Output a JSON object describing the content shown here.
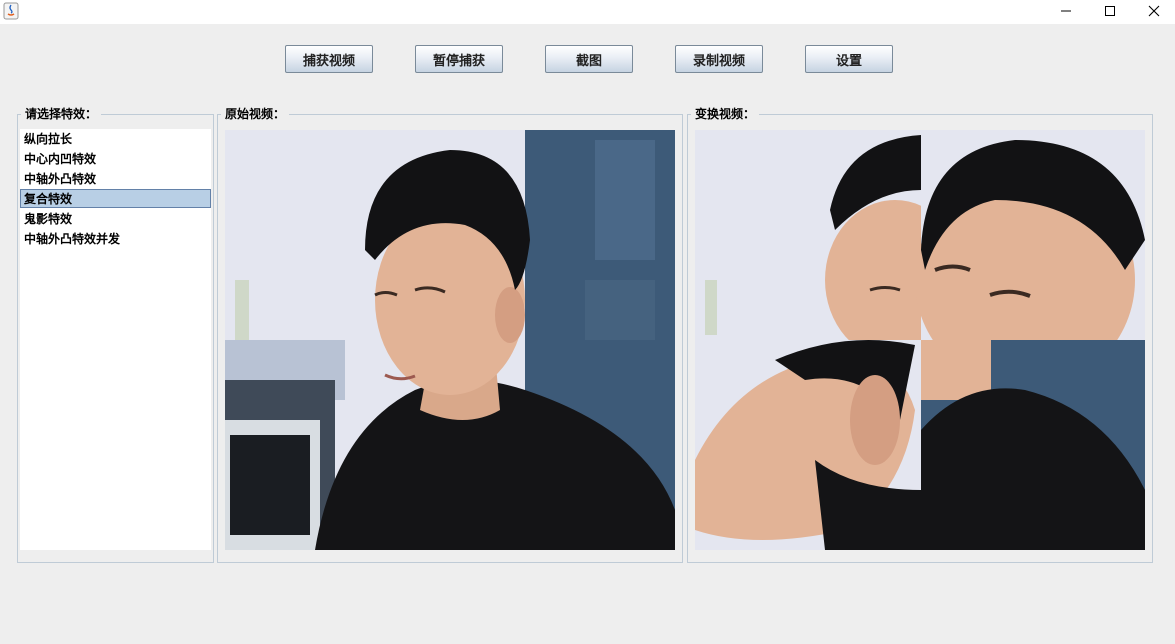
{
  "toolbar": {
    "capture_label": "捕获视频",
    "pause_label": "暂停捕获",
    "screenshot_label": "截图",
    "record_label": "录制视频",
    "settings_label": "设置"
  },
  "effects_panel": {
    "title": "请选择特效：",
    "items": [
      {
        "label": "纵向拉长",
        "selected": false
      },
      {
        "label": "中心内凹特效",
        "selected": false
      },
      {
        "label": "中轴外凸特效",
        "selected": false
      },
      {
        "label": "复合特效",
        "selected": true
      },
      {
        "label": "鬼影特效",
        "selected": false
      },
      {
        "label": "中轴外凸特效并发",
        "selected": false
      }
    ]
  },
  "original_panel": {
    "title": "原始视频："
  },
  "transformed_panel": {
    "title": "变换视频："
  },
  "colors": {
    "window_bg": "#eeeeee",
    "selection_bg": "#b8cfe5",
    "border": "#bfcbd6",
    "door_blue": "#3d5a78"
  },
  "icons": [
    "java-app-icon",
    "minimize-icon",
    "maximize-icon",
    "close-icon"
  ]
}
